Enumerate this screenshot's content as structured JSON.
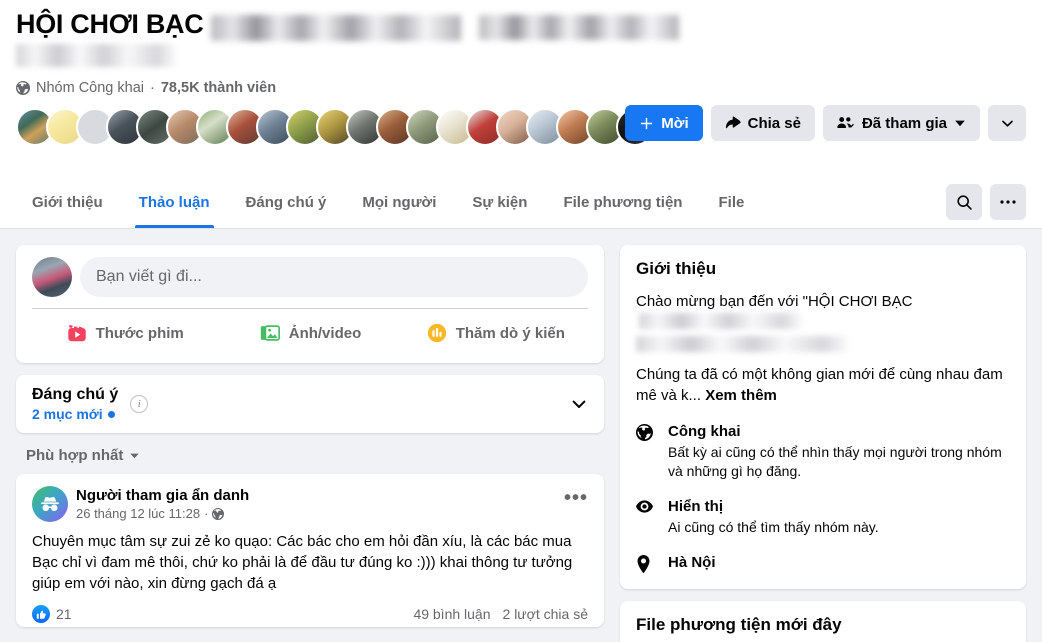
{
  "header": {
    "group_title": "HỘI CHƠI BẠC",
    "privacy_label": "Nhóm Công khai",
    "separator": "·",
    "members_count": "78,5K thành viên",
    "globe_icon": "globe-icon"
  },
  "actions": {
    "invite_label": "Mời",
    "invite_icon": "plus-icon",
    "share_label": "Chia sẻ",
    "share_icon": "share-arrow-icon",
    "joined_label": "Đã tham gia",
    "joined_icon": "members-check-icon",
    "joined_chevron": "chevron-down-icon",
    "more_chevron": "chevron-down-icon"
  },
  "tabs": [
    {
      "label": "Giới thiệu",
      "active": false
    },
    {
      "label": "Thảo luận",
      "active": true
    },
    {
      "label": "Đáng chú ý",
      "active": false
    },
    {
      "label": "Mọi người",
      "active": false
    },
    {
      "label": "Sự kiện",
      "active": false
    },
    {
      "label": "File phương tiện",
      "active": false
    },
    {
      "label": "File",
      "active": false
    }
  ],
  "tabbar_right": {
    "search_icon": "search-icon",
    "more_icon": "ellipsis-icon"
  },
  "composer": {
    "placeholder": "Bạn viết gì đi...",
    "actions": [
      {
        "label": "Thước phim",
        "icon": "reels-clapperboard-icon",
        "color": "#f3425f"
      },
      {
        "label": "Ảnh/video",
        "icon": "photo-video-icon",
        "color": "#45bd62"
      },
      {
        "label": "Thăm dò ý kiến",
        "icon": "poll-bars-icon",
        "color": "#f7b928"
      }
    ]
  },
  "highlights": {
    "title": "Đáng chú ý",
    "subtitle": "2 mục mới",
    "info_icon": "info-icon",
    "chevron_icon": "chevron-down-icon"
  },
  "sort": {
    "label": "Phù hợp nhất",
    "caret_icon": "caret-down-icon"
  },
  "post": {
    "author": "Người tham gia ẩn danh",
    "avatar_icon": "incognito-avatar-icon",
    "timestamp": "26 tháng 12 lúc 11:28",
    "time_separator": "·",
    "audience_icon": "globe-icon",
    "more_icon": "ellipsis-icon",
    "text": "Chuyên mục tâm sự zui zẻ ko quạo: Các bác cho em hỏi đần xíu, là các bác mua Bạc chỉ vì đam mê thôi, chứ ko phải là để đầu tư đúng ko :))) khai thông tư tưởng giúp em với nào, xin đừng gạch đá ạ",
    "like_icon": "like-thumb-icon",
    "like_count": "21",
    "comments": "49 bình luận",
    "shares": "2 lượt chia sẻ"
  },
  "about": {
    "heading": "Giới thiệu",
    "welcome_prefix": "Chào mừng bạn đến với \"HỘI CHƠI BẠC",
    "description": "Chúng ta đã có một không gian mới để cùng nhau đam mê và k...",
    "see_more": "Xem thêm",
    "items": [
      {
        "icon": "globe-icon",
        "title": "Công khai",
        "desc": "Bất kỳ ai cũng có thể nhìn thấy mọi người trong nhóm và những gì họ đăng."
      },
      {
        "icon": "eye-icon",
        "title": "Hiển thị",
        "desc": "Ai cũng có thể tìm thấy nhóm này."
      },
      {
        "icon": "location-pin-icon",
        "title": "Hà Nội",
        "desc": ""
      }
    ]
  },
  "media_card": {
    "heading": "File phương tiện mới đây"
  },
  "colors": {
    "accent_blue": "#1877f2",
    "link_blue": "#1b74e4",
    "page_bg": "#f0f2f5",
    "card_bg": "#ffffff",
    "secondary_text": "#65676b",
    "button_grey": "#e4e6eb"
  }
}
